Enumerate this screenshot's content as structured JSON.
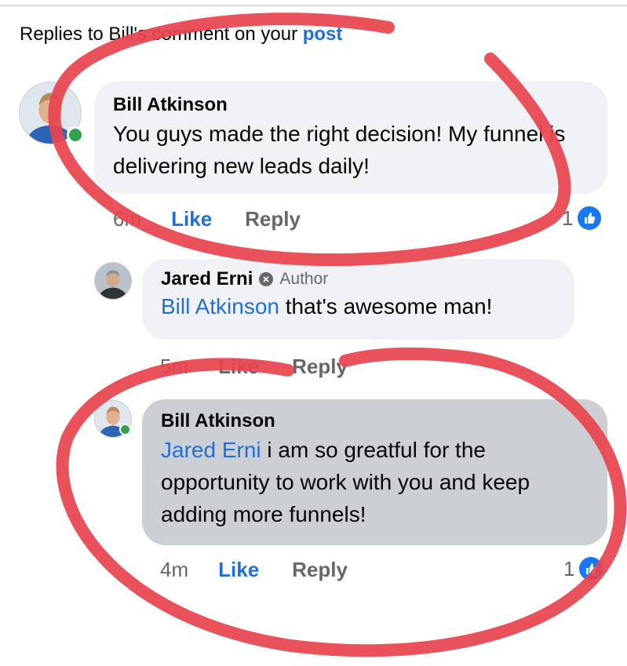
{
  "header": {
    "prefix": "Replies to Bill's comment on your",
    "post_link": "post"
  },
  "comments": [
    {
      "author": "Bill Atkinson",
      "text": "You guys made the right decision! My funnel is delivering new leads daily!",
      "time": "6m",
      "like_label": "Like",
      "reply_label": "Reply",
      "reaction_count": "1",
      "online": true
    },
    {
      "author": "Jared Erni",
      "author_badge": "Author",
      "mention": "Bill Atkinson",
      "text": "that's awesome man!",
      "time": "5m",
      "like_label": "Like",
      "reply_label": "Reply"
    },
    {
      "author": "Bill Atkinson",
      "mention": "Jared Erni",
      "text": "i am so greatful for the opportunity to work with you and keep adding more funnels!",
      "time": "4m",
      "like_label": "Like",
      "reply_label": "Reply",
      "reaction_count": "1",
      "online": true
    }
  ],
  "colors": {
    "link_blue": "#216fdb",
    "bubble": "#f0f2f5",
    "selected_bubble": "#ccd0d5",
    "annotation_red": "#e8454f",
    "online_green": "#31a24c"
  },
  "icons": [
    "like-thumb-icon",
    "author-badge-icon",
    "online-dot"
  ]
}
